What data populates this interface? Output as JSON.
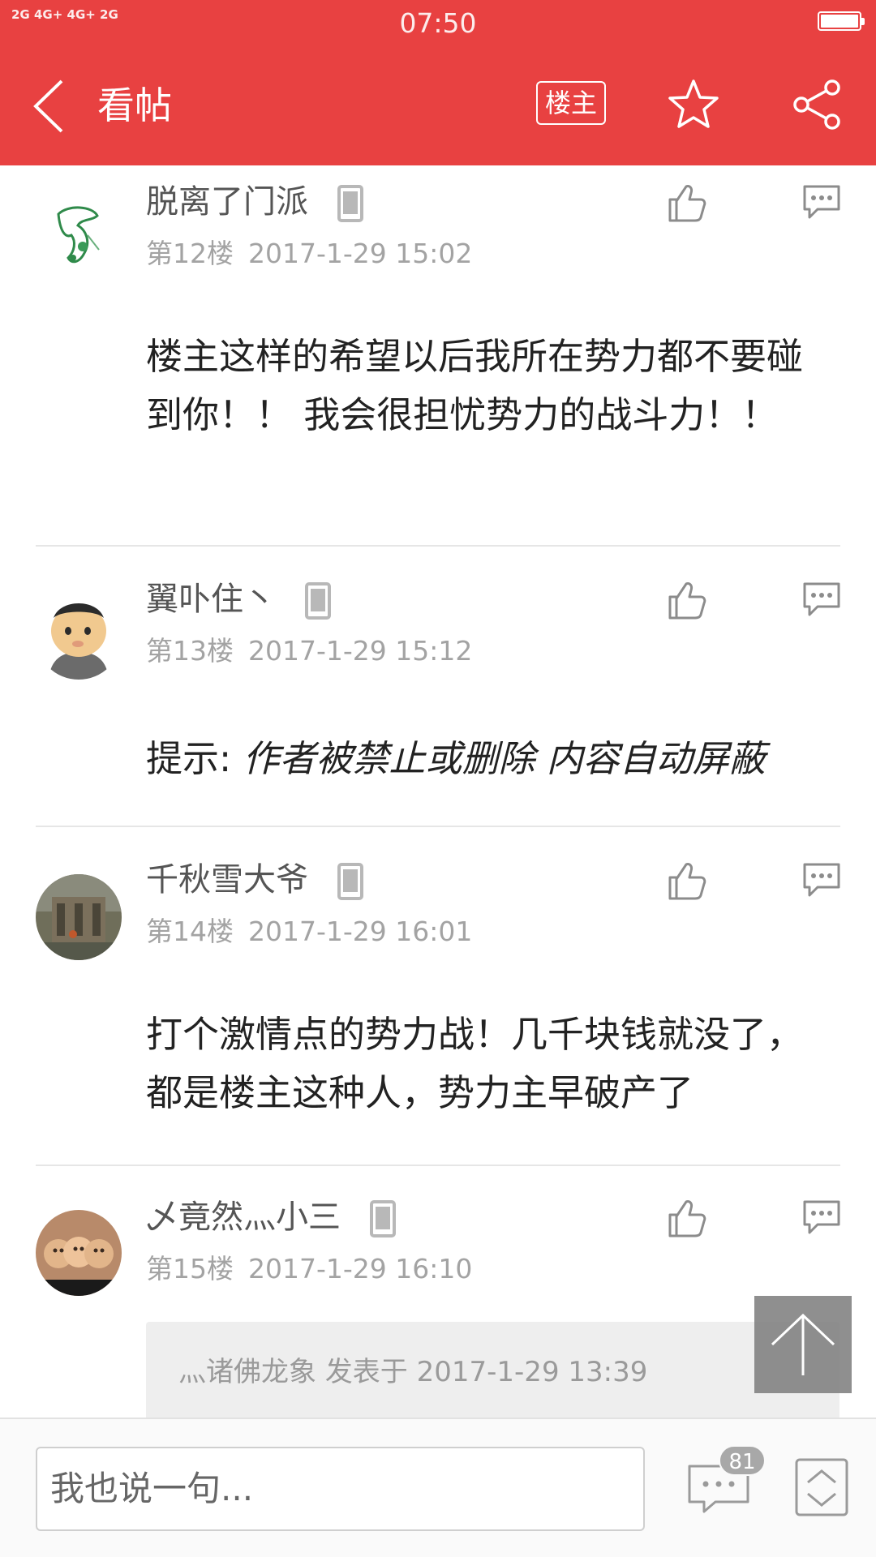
{
  "status_bar": {
    "signal_text": "2G 4G+ 4G+ 2G",
    "time": "07:50"
  },
  "nav": {
    "back_icon": "chevron-left-icon",
    "title": "看帖",
    "owner_label": "楼主",
    "star_icon": "star-icon",
    "share_icon": "share-icon"
  },
  "posts": [
    {
      "username": "脱离了门派",
      "floor": "第12楼",
      "time": "2017-1-29 15:02",
      "body": "楼主这样的希望以后我所在势力都不要碰到你！！ 我会很担忧势力的战斗力！！"
    },
    {
      "username": "翼卟住丶",
      "floor": "第13楼",
      "time": "2017-1-29 15:12",
      "body_prefix": "提示: ",
      "body_italic": "作者被禁止或删除 内容自动屏蔽"
    },
    {
      "username": "千秋雪大爷",
      "floor": "第14楼",
      "time": "2017-1-29 16:01",
      "body": "打个激情点的势力战！几千块钱就没了，都是楼主这种人，势力主早破产了"
    },
    {
      "username": "乄竟然灬小三",
      "floor": "第15楼",
      "time": "2017-1-29 16:10",
      "quote": "灬诸佛龙象 发表于 2017-1-29 13:39"
    }
  ],
  "bottom_bar": {
    "input_placeholder": "我也说一句...",
    "comment_count": "81"
  },
  "colors": {
    "brand_red": "#e84141",
    "meta_gray": "#a3a3a3"
  }
}
